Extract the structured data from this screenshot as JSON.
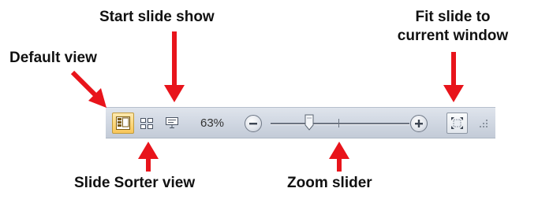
{
  "annotations": {
    "start_slide_show": "Start slide show",
    "fit_slide_line1": "Fit slide to",
    "fit_slide_line2": "current window",
    "default_view": "Default view",
    "slide_sorter_view": "Slide Sorter view",
    "zoom_slider": "Zoom slider"
  },
  "statusbar": {
    "zoom_percent": "63%",
    "active_view": "normal",
    "zoom_level": 63
  },
  "colors": {
    "arrow": "#e8141b",
    "statusbar": "#d3d9e3",
    "active_button": "#fbd577"
  },
  "icons": [
    "normal-view-icon",
    "slide-sorter-icon",
    "slide-show-icon",
    "zoom-out-icon",
    "zoom-in-icon",
    "fit-to-window-icon",
    "resize-grip-icon"
  ]
}
